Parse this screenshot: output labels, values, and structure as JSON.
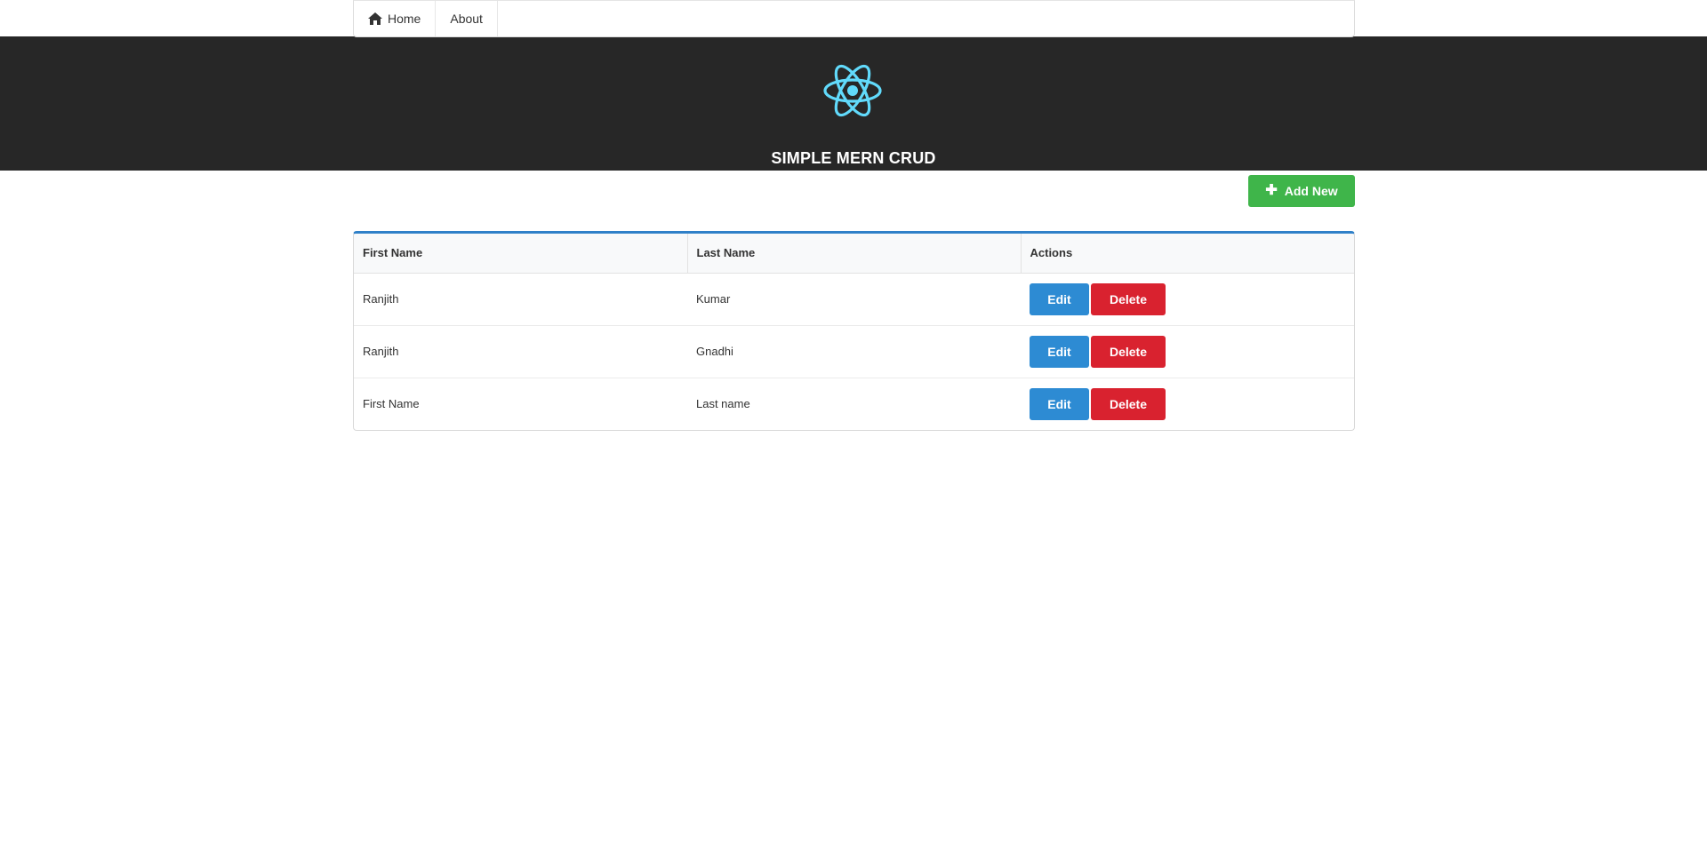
{
  "nav": {
    "home_label": "Home",
    "about_label": "About"
  },
  "header": {
    "logo_icon": "react-atom-icon",
    "title": "SIMPLE MERN CRUD",
    "logo_color": "#61dafb",
    "background": "#272727"
  },
  "toolbar": {
    "add_label": "Add New",
    "add_icon": "plus-icon",
    "add_color": "#3fb54a"
  },
  "table": {
    "columns": [
      "First Name",
      "Last Name",
      "Actions"
    ],
    "rows": [
      {
        "first": "Ranjith",
        "last": "Kumar",
        "edit": "Edit",
        "delete": "Delete"
      },
      {
        "first": "Ranjith",
        "last": "Gnadhi",
        "edit": "Edit",
        "delete": "Delete"
      },
      {
        "first": "First Name",
        "last": "Last name",
        "edit": "Edit",
        "delete": "Delete"
      }
    ],
    "edit_color": "#2d8bd3",
    "delete_color": "#d9222f",
    "accent_color": "#2f80c8"
  }
}
